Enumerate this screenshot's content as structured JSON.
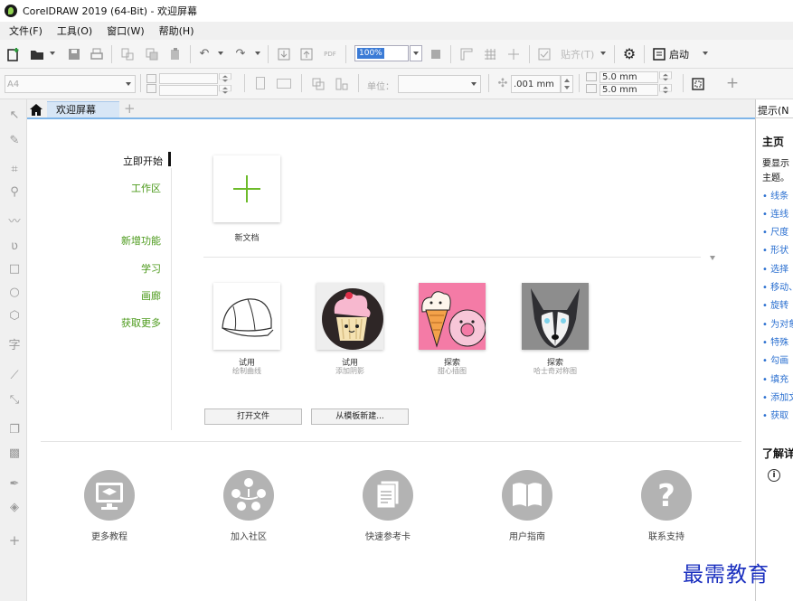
{
  "window": {
    "title": "CorelDRAW 2019 (64-Bit) - 欢迎屏幕"
  },
  "menu": [
    "文件(F)",
    "工具(O)",
    "窗口(W)",
    "帮助(H)"
  ],
  "toolbar": {
    "zoom_value": "100%",
    "snap_label": "贴齐(T)",
    "launch_label": "启动"
  },
  "propertybar": {
    "page_size": "A4",
    "units_label": "单位：",
    "nudge": ".001 mm",
    "dup_x": "5.0 mm",
    "dup_y": "5.0 mm"
  },
  "tabs": {
    "welcome_label": "欢迎屏幕"
  },
  "nav": {
    "items": [
      {
        "label": "立即开始",
        "active": true
      },
      {
        "label": "工作区",
        "active": false
      },
      {
        "label": "新增功能",
        "active": false
      },
      {
        "label": "学习",
        "active": false
      },
      {
        "label": "画廊",
        "active": false
      },
      {
        "label": "获取更多",
        "active": false
      }
    ]
  },
  "start": {
    "new_doc_label": "新文档",
    "templates": [
      {
        "title": "试用",
        "subtitle": "绘制曲线",
        "icon": "cap-drawing"
      },
      {
        "title": "试用",
        "subtitle": "添加阴影",
        "icon": "cupcake"
      },
      {
        "title": "探索",
        "subtitle": "甜心插图",
        "icon": "icecream-donut"
      },
      {
        "title": "探索",
        "subtitle": "哈士奇对称图",
        "icon": "husky"
      }
    ],
    "open_file_label": "打开文件",
    "from_template_label": "从模板新建..."
  },
  "resources": [
    {
      "label": "更多教程",
      "icon": "monitor-graduation-icon"
    },
    {
      "label": "加入社区",
      "icon": "community-icon"
    },
    {
      "label": "快速参考卡",
      "icon": "cards-icon"
    },
    {
      "label": "用户指南",
      "icon": "book-icon"
    },
    {
      "label": "联系支持",
      "icon": "question-icon"
    }
  ],
  "hints": {
    "header": "提示(N",
    "title": "主页",
    "intro_1": "要显示",
    "intro_2": "主题。",
    "links": [
      "线条",
      "连线",
      "尺度",
      "形状",
      "选择",
      "移动、",
      "旋转",
      "为对象",
      "特殊",
      "勾画",
      "填充",
      "添加文",
      "获取"
    ],
    "learn_title": "了解详"
  },
  "watermark": "最需教育",
  "colors": {
    "accent_green": "#4c9a1b",
    "link_blue": "#2a6fd0",
    "tab_underline": "#7fb5e8"
  }
}
